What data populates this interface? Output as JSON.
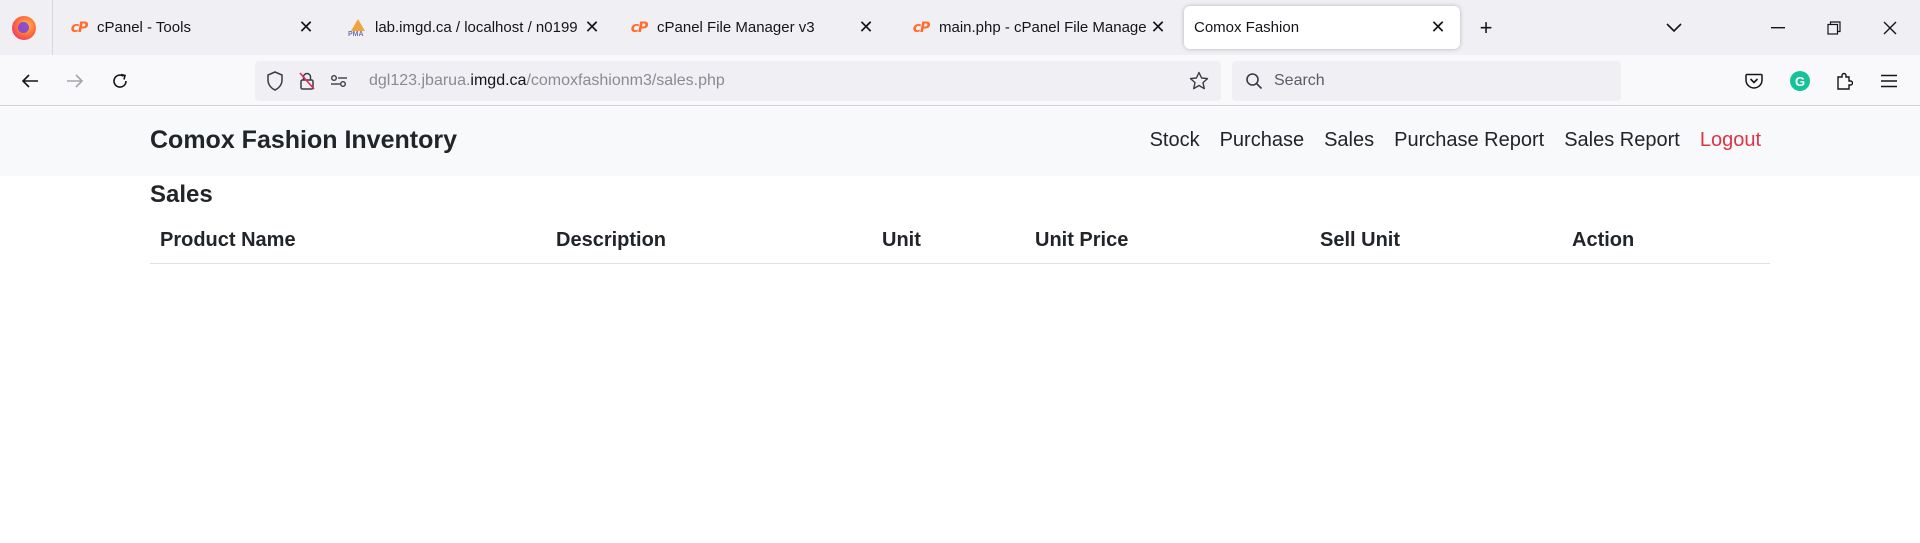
{
  "browser": {
    "tabs": [
      {
        "title": "cPanel - Tools",
        "icon": "cpanel-icon",
        "active": false
      },
      {
        "title": "lab.imgd.ca / localhost / n0199",
        "icon": "phpmyadmin-icon",
        "active": false
      },
      {
        "title": "cPanel File Manager v3",
        "icon": "cpanel-icon",
        "active": false
      },
      {
        "title": "main.php - cPanel File Manager",
        "icon": "cpanel-icon",
        "active": false
      },
      {
        "title": "Comox Fashion",
        "icon": "",
        "active": true
      }
    ],
    "pma_icon_text": "PMA",
    "url": {
      "prefix": "dgl123.jbarua.",
      "domain": "imgd.ca",
      "path": "/comoxfashionm3/sales.php"
    },
    "search_placeholder": "Search"
  },
  "site": {
    "brand": "Comox Fashion Inventory",
    "menu": [
      {
        "label": "Stock"
      },
      {
        "label": "Purchase"
      },
      {
        "label": "Sales"
      },
      {
        "label": "Purchase Report"
      },
      {
        "label": "Sales Report"
      },
      {
        "label": "Logout",
        "color": "#dc3545"
      }
    ]
  },
  "page": {
    "title": "Sales",
    "table": {
      "headers": [
        "Product Name",
        "Description",
        "Unit",
        "Unit Price",
        "Sell Unit",
        "Action"
      ],
      "rows": []
    }
  }
}
